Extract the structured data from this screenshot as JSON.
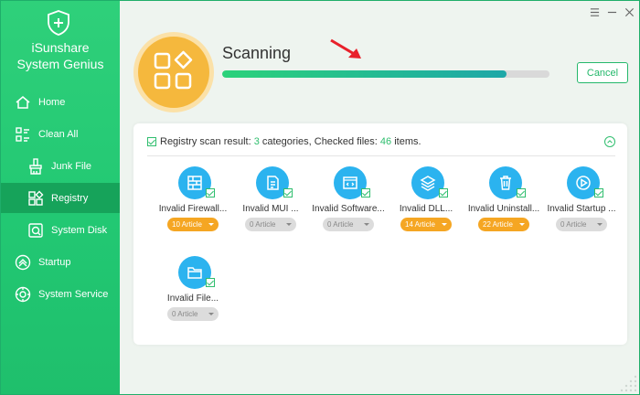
{
  "app": {
    "name_line1": "iSunshare",
    "name_line2": "System Genius"
  },
  "sidebar": {
    "items": [
      {
        "label": "Home",
        "icon": "home-icon"
      },
      {
        "label": "Clean All",
        "icon": "clean-all-icon"
      },
      {
        "label": "Junk File",
        "icon": "brush-icon"
      },
      {
        "label": "Registry",
        "icon": "registry-icon",
        "active": true
      },
      {
        "label": "System Disk",
        "icon": "disk-icon"
      },
      {
        "label": "Startup",
        "icon": "startup-icon"
      },
      {
        "label": "System Service",
        "icon": "service-icon"
      }
    ]
  },
  "scan": {
    "title": "Scanning",
    "progress": 0.87,
    "cancel_label": "Cancel"
  },
  "results": {
    "prefix": "Registry scan result: ",
    "categories": "3",
    "mid": " categories, Checked files: ",
    "files": "46",
    "suffix": " items."
  },
  "items": [
    {
      "label": "Invalid Firewall...",
      "badge": "10 Article",
      "style": "orange",
      "icon": "firewall-icon"
    },
    {
      "label": "Invalid MUI ...",
      "badge": "0 Article",
      "style": "gray",
      "icon": "document-icon"
    },
    {
      "label": "Invalid Software...",
      "badge": "0 Article",
      "style": "gray",
      "icon": "software-window-icon"
    },
    {
      "label": "Invalid DLL...",
      "badge": "14 Article",
      "style": "orange",
      "icon": "layers-icon"
    },
    {
      "label": "Invalid Uninstall...",
      "badge": "22 Article",
      "style": "orange",
      "icon": "trash-icon"
    },
    {
      "label": "Invalid Startup ...",
      "badge": "0 Article",
      "style": "gray",
      "icon": "play-icon"
    },
    {
      "label": "Invalid File...",
      "badge": "0 Article",
      "style": "gray",
      "icon": "folder-icon"
    }
  ],
  "colors": {
    "sidebar": "#22c873",
    "active_nav": "#16a35a",
    "accent": "#2fbe6e",
    "icon_blue": "#2bb3ef",
    "badge_orange": "#f5a623",
    "scan_circle": "#f5b83d"
  }
}
